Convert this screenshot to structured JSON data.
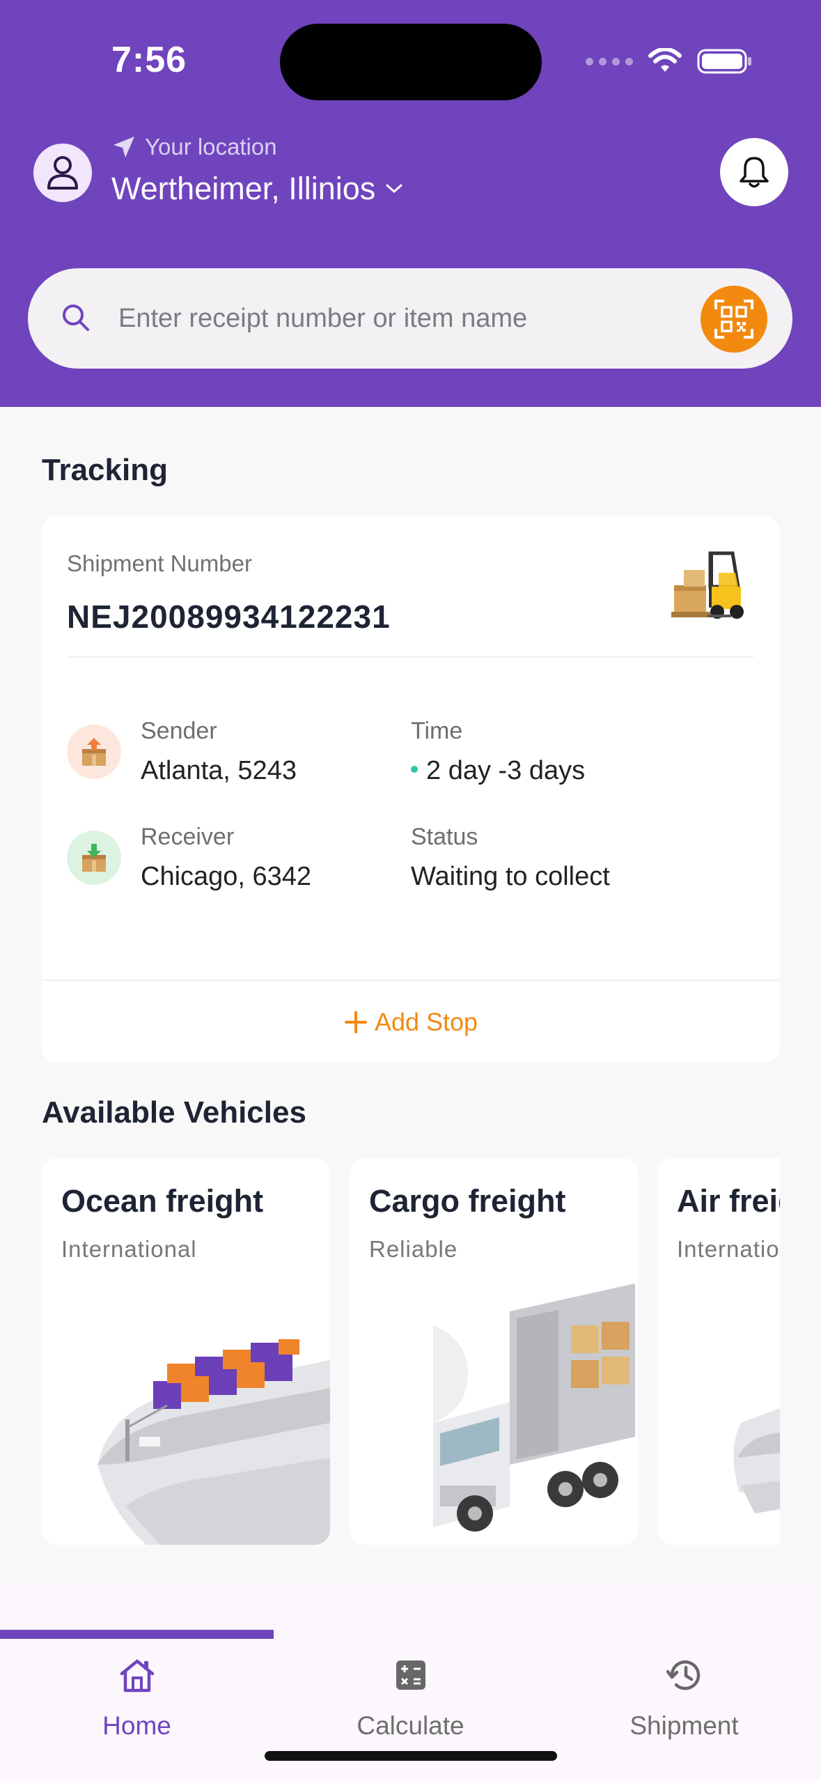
{
  "status_bar": {
    "time": "7:56"
  },
  "header": {
    "location_label": "Your location",
    "location_value": "Wertheimer, Illinios"
  },
  "search": {
    "placeholder": "Enter receipt number or item name"
  },
  "tracking": {
    "section_title": "Tracking",
    "shipment_label": "Shipment Number",
    "shipment_number": "NEJ20089934122231",
    "sender_label": "Sender",
    "sender_value": "Atlanta, 5243",
    "time_label": "Time",
    "time_value": "2 day -3 days",
    "receiver_label": "Receiver",
    "receiver_value": "Chicago, 6342",
    "status_label": "Status",
    "status_value": "Waiting to collect",
    "add_stop_label": "Add Stop"
  },
  "vehicles": {
    "section_title": "Available Vehicles",
    "items": [
      {
        "title": "Ocean freight",
        "subtitle": "International"
      },
      {
        "title": "Cargo freight",
        "subtitle": "Reliable"
      },
      {
        "title": "Air freight",
        "subtitle": "International"
      }
    ]
  },
  "nav": {
    "items": [
      {
        "label": "Home",
        "icon": "home-icon",
        "active": true
      },
      {
        "label": "Calculate",
        "icon": "calculator-icon",
        "active": false
      },
      {
        "label": "Shipment",
        "icon": "history-icon",
        "active": false
      }
    ]
  },
  "colors": {
    "brand_purple": "#7044bd",
    "accent_orange": "#f28a10",
    "time_dot_teal": "#2fc4a7"
  }
}
